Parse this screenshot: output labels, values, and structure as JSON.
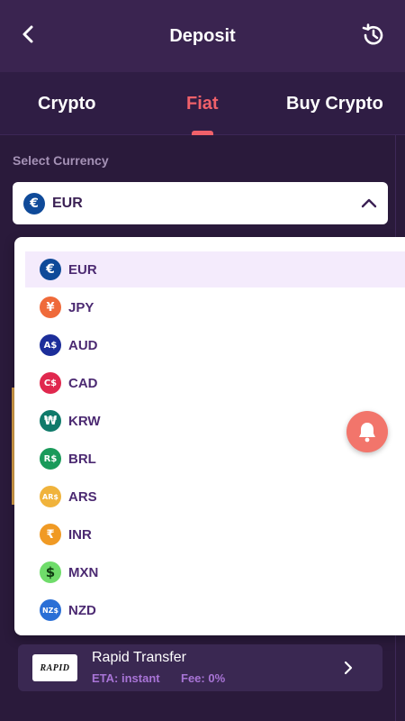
{
  "header": {
    "title": "Deposit",
    "back_icon": "chevron-left-icon",
    "history_icon": "history-icon"
  },
  "tabs": [
    {
      "label": "Crypto"
    },
    {
      "label": "Fiat",
      "active": true
    },
    {
      "label": "Buy Crypto"
    }
  ],
  "currency_select": {
    "label": "Select Currency",
    "selected": "EUR",
    "selected_symbol": "€"
  },
  "currency_options": [
    {
      "code": "EUR",
      "symbol": "€",
      "color": "#0f4a99",
      "selected": true
    },
    {
      "code": "JPY",
      "symbol": "¥",
      "color": "#ef6a3a"
    },
    {
      "code": "AUD",
      "symbol": "A$",
      "color": "#1c2e9a"
    },
    {
      "code": "CAD",
      "symbol": "C$",
      "color": "#e0284e"
    },
    {
      "code": "KRW",
      "symbol": "₩",
      "color": "#0f7a6a"
    },
    {
      "code": "BRL",
      "symbol": "R$",
      "color": "#1a9a5a"
    },
    {
      "code": "ARS",
      "symbol": "AR$",
      "color": "#f0b33c"
    },
    {
      "code": "INR",
      "symbol": "₹",
      "color": "#f09a24"
    },
    {
      "code": "MXN",
      "symbol": "$",
      "color": "#6fdc6a"
    },
    {
      "code": "NZD",
      "symbol": "NZ$",
      "color": "#2a6fd6"
    }
  ],
  "payment_method": {
    "logo_text": "RAPID",
    "name": "Rapid Transfer",
    "eta": "ETA: instant",
    "fee": "Fee: 0%"
  },
  "colors": {
    "accent": "#f0616a",
    "bg": "#2a1a3b",
    "header": "#3a2450",
    "item_text": "#4c2a72",
    "meta_text": "#a874d6"
  }
}
